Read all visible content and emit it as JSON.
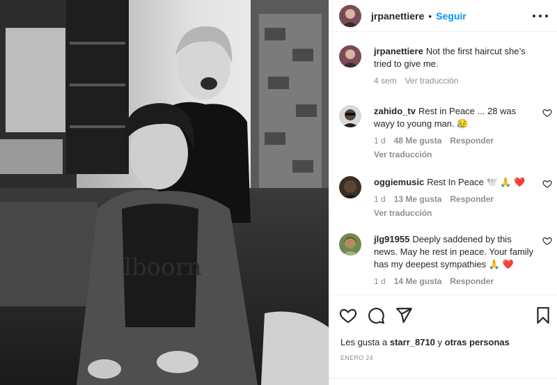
{
  "post": {
    "username": "jrpanettiere",
    "dot": "•",
    "follow_label": "Seguir",
    "more_icon": "more-horizontal-icon"
  },
  "caption": {
    "username": "jrpanettiere",
    "text": "Not the first haircut she’s tried to give me.",
    "time": "4 sem",
    "translate": "Ver traducción"
  },
  "comments": [
    {
      "username": "zahido_tv",
      "text": "Rest in Peace ... 28 was wayy to young man. 😥",
      "time": "1 d",
      "likes": "48 Me gusta",
      "reply": "Responder",
      "translate": "Ver traducción"
    },
    {
      "username": "oggiemusic",
      "text": "Rest In Peace 🕊️ 🙏 ❤️",
      "time": "1 d",
      "likes": "13 Me gusta",
      "reply": "Responder",
      "translate": "Ver traducción"
    },
    {
      "username": "jlg91955",
      "text": "Deeply saddened by this news. May he rest in peace. Your family has my deepest sympathies 🙏 ❤️",
      "time": "1 d",
      "likes": "14 Me gusta",
      "reply": "Responder"
    }
  ],
  "footer": {
    "likes_prefix": "Les gusta a",
    "likes_user": "starr_8710",
    "likes_conj": "y",
    "likes_others": "otras personas",
    "date": "ENERO 24"
  },
  "colors": {
    "accent": "#0095f6",
    "text": "#262626",
    "secondary": "#8e8e8e",
    "border": "#efefef"
  }
}
